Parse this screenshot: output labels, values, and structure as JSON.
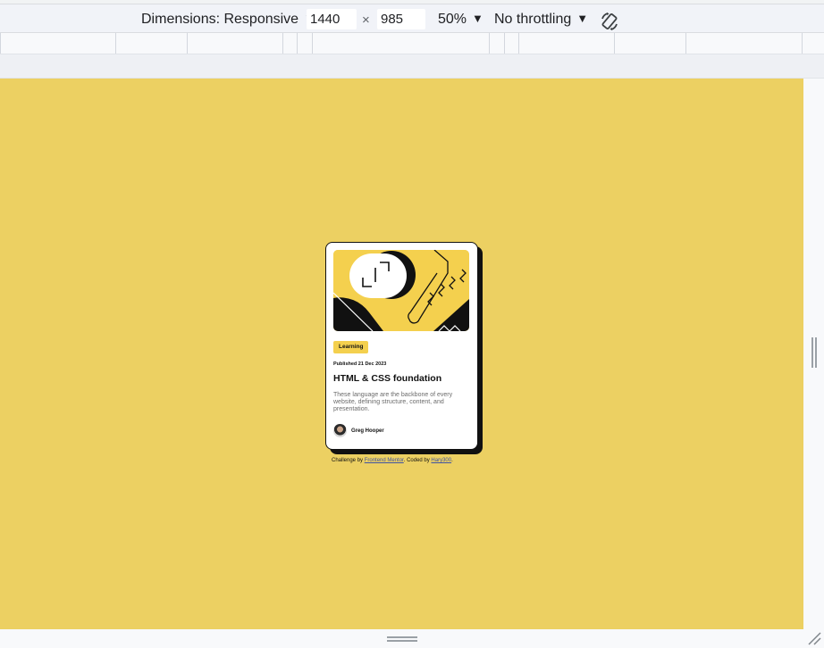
{
  "toolbar": {
    "dimensions_label": "Dimensions: Responsive",
    "width_value": "1440",
    "times_symbol": "×",
    "height_value": "985",
    "zoom_label": "50%",
    "throttling_label": "No throttling",
    "caret": "▼",
    "rotate_icon": "rotate-icon"
  },
  "viewport": {
    "background_color": "#ecd062"
  },
  "card": {
    "tag": "Learning",
    "published": "Published 21 Dec 2023",
    "title": "HTML & CSS foundation",
    "description": "These language are the backbone of every website, defining structure, content, and presentation.",
    "author": "Greg Hooper"
  },
  "attribution": {
    "prefix": "Challenge by ",
    "link1": "Frontend Mentor",
    "middle": ". Coded by ",
    "link2": "Hary300",
    "suffix": "."
  },
  "colors": {
    "accent_yellow": "#f4d04e",
    "ink": "#111111"
  }
}
